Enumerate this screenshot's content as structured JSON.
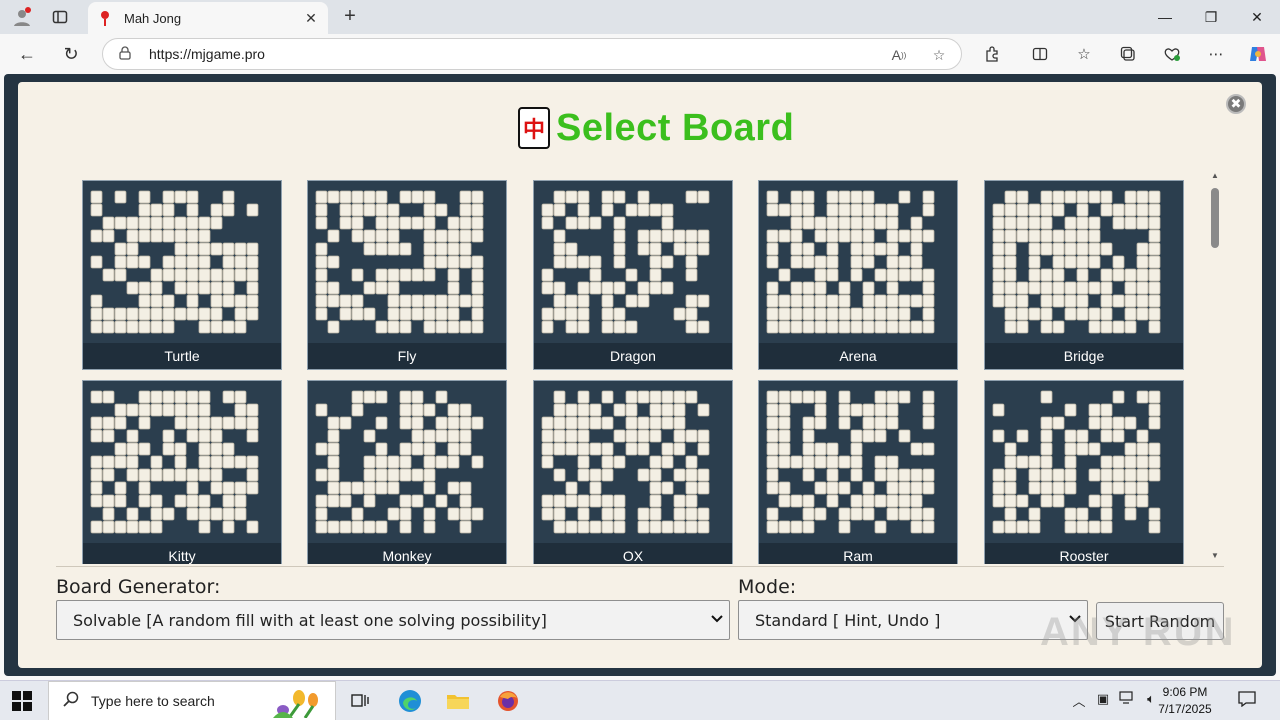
{
  "browser": {
    "tab_title": "Mah Jong",
    "url": "https://mjgame.pro"
  },
  "dialog": {
    "title": "Select Board",
    "logo_glyph": "中",
    "close_glyph": "✖"
  },
  "boards": [
    {
      "name": "Turtle",
      "seed": 3,
      "density": 0.86
    },
    {
      "name": "Fly",
      "seed": 7,
      "density": 0.62
    },
    {
      "name": "Dragon",
      "seed": 11,
      "density": 0.58
    },
    {
      "name": "Arena",
      "seed": 13,
      "density": 0.72
    },
    {
      "name": "Bridge",
      "seed": 17,
      "density": 0.8
    },
    {
      "name": "Kitty",
      "seed": 19,
      "density": 0.7
    },
    {
      "name": "Monkey",
      "seed": 23,
      "density": 0.6
    },
    {
      "name": "OX",
      "seed": 29,
      "density": 0.74
    },
    {
      "name": "Ram",
      "seed": 31,
      "density": 0.7
    },
    {
      "name": "Rooster",
      "seed": 37,
      "density": 0.6
    }
  ],
  "controls": {
    "generator_label": "Board Generator:",
    "generator_value": "Solvable [A random fill with at least one solving possibility]",
    "mode_label": "Mode:",
    "mode_value": "Standard [ Hint, Undo ]",
    "start_label": "Start Random"
  },
  "taskbar": {
    "search_placeholder": "Type here to search",
    "time": "9:06 PM",
    "date": "7/17/2025"
  },
  "watermark": "ANY RUN",
  "colors": {
    "title_green": "#3bbf1d",
    "board_bg": "#2b3e4e",
    "tile": "#f3efe4"
  }
}
